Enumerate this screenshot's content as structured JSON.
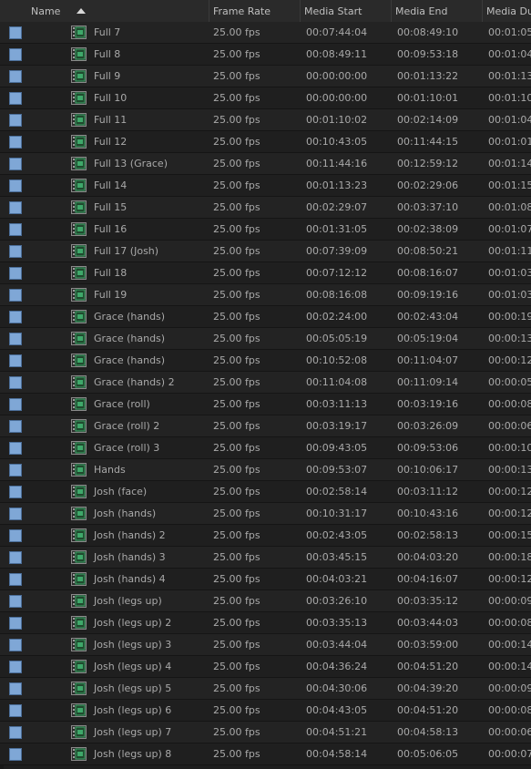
{
  "columns": {
    "name": "Name",
    "frame_rate": "Frame Rate",
    "media_start": "Media Start",
    "media_end": "Media End",
    "media_duration": "Media Du"
  },
  "label_color": "#7fa7d6",
  "rows": [
    {
      "name": "Full 7",
      "fps": "25.00 fps",
      "start": "00:07:44:04",
      "end": "00:08:49:10",
      "dur": "00:01:05"
    },
    {
      "name": "Full 8",
      "fps": "25.00 fps",
      "start": "00:08:49:11",
      "end": "00:09:53:18",
      "dur": "00:01:04"
    },
    {
      "name": "Full 9",
      "fps": "25.00 fps",
      "start": "00:00:00:00",
      "end": "00:01:13:22",
      "dur": "00:01:13"
    },
    {
      "name": "Full 10",
      "fps": "25.00 fps",
      "start": "00:00:00:00",
      "end": "00:01:10:01",
      "dur": "00:01:10"
    },
    {
      "name": "Full 11",
      "fps": "25.00 fps",
      "start": "00:01:10:02",
      "end": "00:02:14:09",
      "dur": "00:01:04"
    },
    {
      "name": "Full 12",
      "fps": "25.00 fps",
      "start": "00:10:43:05",
      "end": "00:11:44:15",
      "dur": "00:01:01"
    },
    {
      "name": "Full 13 (Grace)",
      "fps": "25.00 fps",
      "start": "00:11:44:16",
      "end": "00:12:59:12",
      "dur": "00:01:14"
    },
    {
      "name": "Full 14",
      "fps": "25.00 fps",
      "start": "00:01:13:23",
      "end": "00:02:29:06",
      "dur": "00:01:15"
    },
    {
      "name": "Full 15",
      "fps": "25.00 fps",
      "start": "00:02:29:07",
      "end": "00:03:37:10",
      "dur": "00:01:08"
    },
    {
      "name": "Full 16",
      "fps": "25.00 fps",
      "start": "00:01:31:05",
      "end": "00:02:38:09",
      "dur": "00:01:07"
    },
    {
      "name": "Full 17 (Josh)",
      "fps": "25.00 fps",
      "start": "00:07:39:09",
      "end": "00:08:50:21",
      "dur": "00:01:11"
    },
    {
      "name": "Full 18",
      "fps": "25.00 fps",
      "start": "00:07:12:12",
      "end": "00:08:16:07",
      "dur": "00:01:03"
    },
    {
      "name": "Full 19",
      "fps": "25.00 fps",
      "start": "00:08:16:08",
      "end": "00:09:19:16",
      "dur": "00:01:03"
    },
    {
      "name": "Grace (hands)",
      "fps": "25.00 fps",
      "start": "00:02:24:00",
      "end": "00:02:43:04",
      "dur": "00:00:19"
    },
    {
      "name": "Grace (hands)",
      "fps": "25.00 fps",
      "start": "00:05:05:19",
      "end": "00:05:19:04",
      "dur": "00:00:13"
    },
    {
      "name": "Grace (hands)",
      "fps": "25.00 fps",
      "start": "00:10:52:08",
      "end": "00:11:04:07",
      "dur": "00:00:12"
    },
    {
      "name": "Grace (hands) 2",
      "fps": "25.00 fps",
      "start": "00:11:04:08",
      "end": "00:11:09:14",
      "dur": "00:00:05"
    },
    {
      "name": "Grace (roll)",
      "fps": "25.00 fps",
      "start": "00:03:11:13",
      "end": "00:03:19:16",
      "dur": "00:00:08"
    },
    {
      "name": "Grace (roll) 2",
      "fps": "25.00 fps",
      "start": "00:03:19:17",
      "end": "00:03:26:09",
      "dur": "00:00:06"
    },
    {
      "name": "Grace (roll) 3",
      "fps": "25.00 fps",
      "start": "00:09:43:05",
      "end": "00:09:53:06",
      "dur": "00:00:10"
    },
    {
      "name": "Hands",
      "fps": "25.00 fps",
      "start": "00:09:53:07",
      "end": "00:10:06:17",
      "dur": "00:00:13"
    },
    {
      "name": "Josh (face)",
      "fps": "25.00 fps",
      "start": "00:02:58:14",
      "end": "00:03:11:12",
      "dur": "00:00:12"
    },
    {
      "name": "Josh (hands)",
      "fps": "25.00 fps",
      "start": "00:10:31:17",
      "end": "00:10:43:16",
      "dur": "00:00:12"
    },
    {
      "name": "Josh (hands) 2",
      "fps": "25.00 fps",
      "start": "00:02:43:05",
      "end": "00:02:58:13",
      "dur": "00:00:15"
    },
    {
      "name": "Josh (hands) 3",
      "fps": "25.00 fps",
      "start": "00:03:45:15",
      "end": "00:04:03:20",
      "dur": "00:00:18"
    },
    {
      "name": "Josh (hands) 4",
      "fps": "25.00 fps",
      "start": "00:04:03:21",
      "end": "00:04:16:07",
      "dur": "00:00:12"
    },
    {
      "name": "Josh (legs up)",
      "fps": "25.00 fps",
      "start": "00:03:26:10",
      "end": "00:03:35:12",
      "dur": "00:00:09"
    },
    {
      "name": "Josh (legs up) 2",
      "fps": "25.00 fps",
      "start": "00:03:35:13",
      "end": "00:03:44:03",
      "dur": "00:00:08"
    },
    {
      "name": "Josh (legs up) 3",
      "fps": "25.00 fps",
      "start": "00:03:44:04",
      "end": "00:03:59:00",
      "dur": "00:00:14"
    },
    {
      "name": "Josh (legs up) 4",
      "fps": "25.00 fps",
      "start": "00:04:36:24",
      "end": "00:04:51:20",
      "dur": "00:00:14"
    },
    {
      "name": "Josh (legs up) 5",
      "fps": "25.00 fps",
      "start": "00:04:30:06",
      "end": "00:04:39:20",
      "dur": "00:00:09"
    },
    {
      "name": "Josh (legs up) 6",
      "fps": "25.00 fps",
      "start": "00:04:43:05",
      "end": "00:04:51:20",
      "dur": "00:00:08"
    },
    {
      "name": "Josh (legs up) 7",
      "fps": "25.00 fps",
      "start": "00:04:51:21",
      "end": "00:04:58:13",
      "dur": "00:00:06"
    },
    {
      "name": "Josh (legs up) 8",
      "fps": "25.00 fps",
      "start": "00:04:58:14",
      "end": "00:05:06:05",
      "dur": "00:00:07"
    }
  ]
}
